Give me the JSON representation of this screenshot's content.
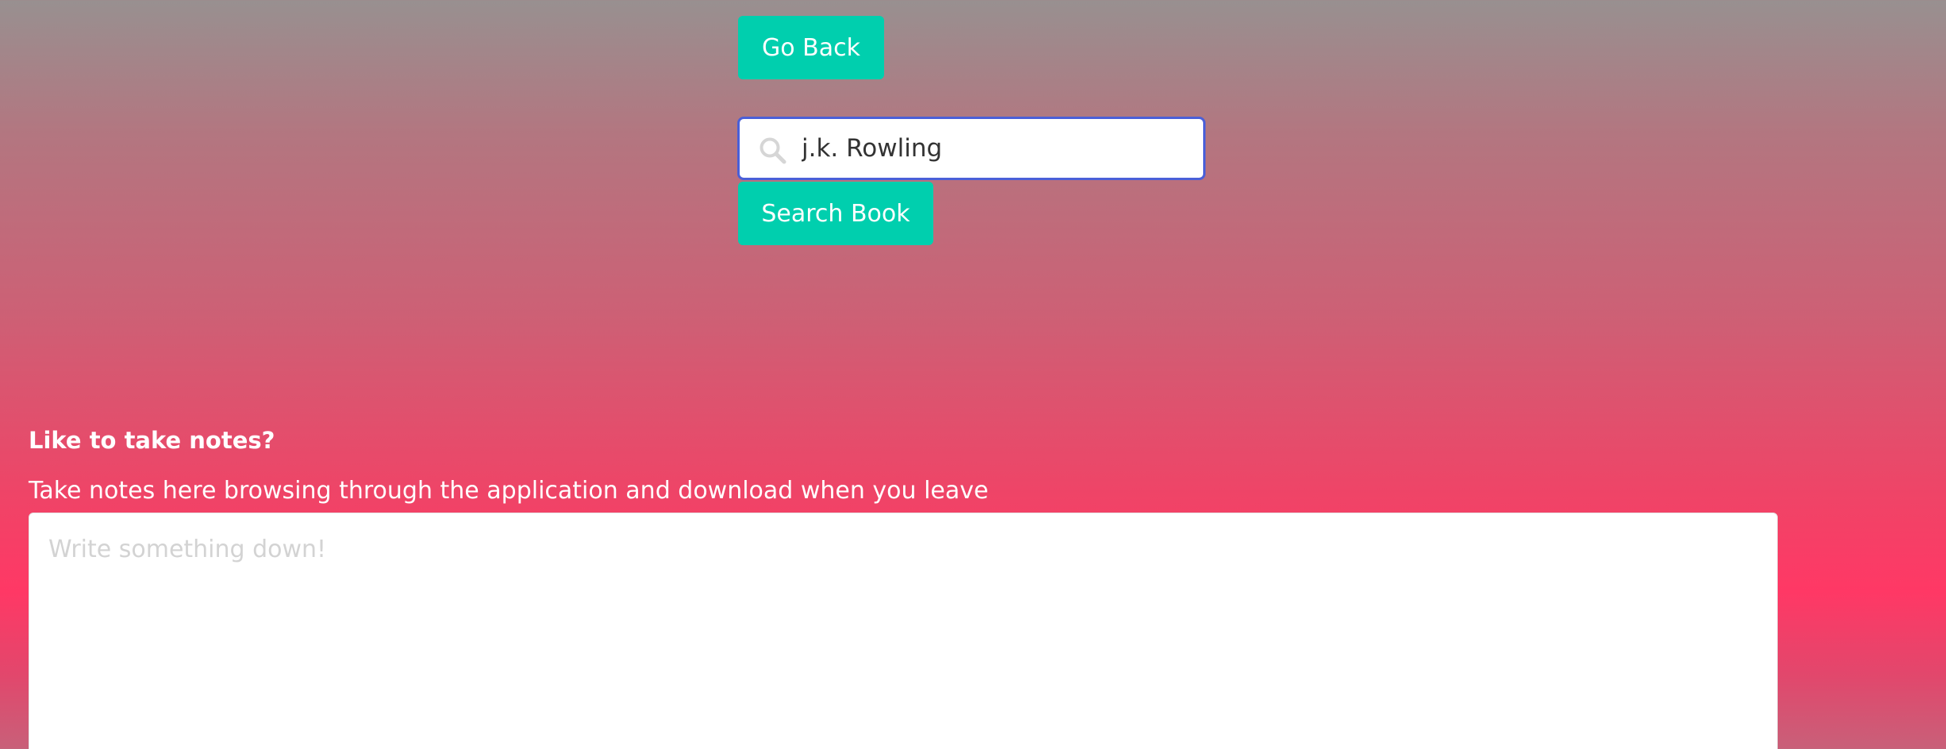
{
  "colors": {
    "button_bg": "#00cfae",
    "button_text": "#ffffff",
    "input_focus_border": "#4a5fd8",
    "placeholder": "#d3d3d3"
  },
  "nav": {
    "go_back_label": "Go Back"
  },
  "search": {
    "icon": "search-icon",
    "value": "j.k. Rowling",
    "button_label": "Search Book"
  },
  "notes": {
    "heading": "Like to take notes?",
    "description": "Take notes here browsing through the application and download when you leave",
    "placeholder": "Write something down!",
    "value": ""
  }
}
